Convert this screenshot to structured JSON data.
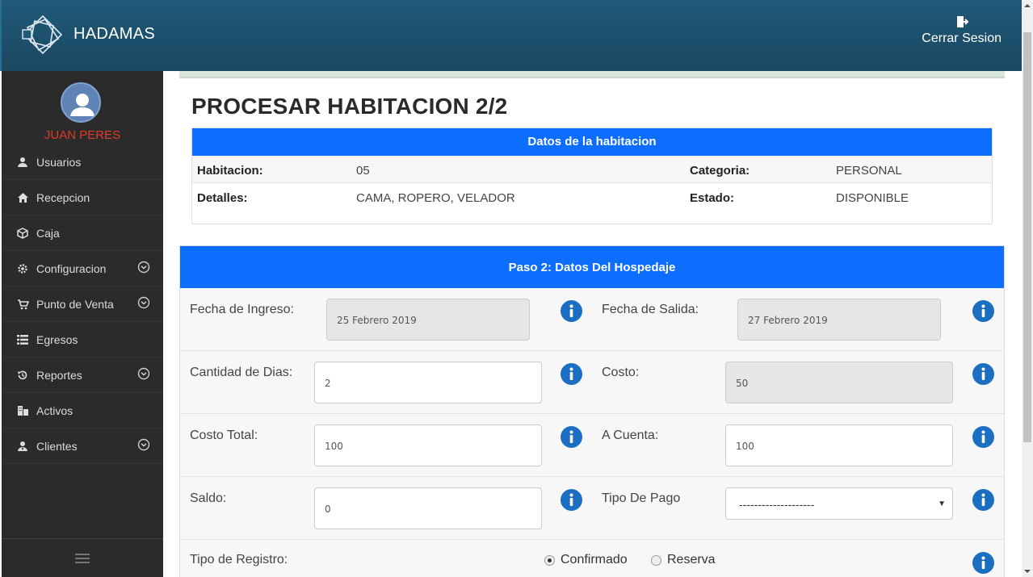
{
  "app": {
    "brand": "HADAMAS",
    "logout_label": "Cerrar Sesion"
  },
  "user": {
    "name": "JUAN PERES"
  },
  "sidebar": {
    "items": [
      {
        "label": "Usuarios",
        "icon": "user-icon",
        "expandable": false
      },
      {
        "label": "Recepcion",
        "icon": "home-icon",
        "expandable": false
      },
      {
        "label": "Caja",
        "icon": "cube-icon",
        "expandable": false
      },
      {
        "label": "Configuracion",
        "icon": "gear-icon",
        "expandable": true
      },
      {
        "label": "Punto de Venta",
        "icon": "cart-icon",
        "expandable": true
      },
      {
        "label": "Egresos",
        "icon": "list-icon",
        "expandable": false
      },
      {
        "label": "Reportes",
        "icon": "history-icon",
        "expandable": true
      },
      {
        "label": "Activos",
        "icon": "building-icon",
        "expandable": false
      },
      {
        "label": "Clientes",
        "icon": "user-tie-icon",
        "expandable": true
      }
    ]
  },
  "page": {
    "title": "PROCESAR HABITACION 2/2"
  },
  "room": {
    "header": "Datos de la habitacion",
    "habitacion_label": "Habitacion:",
    "habitacion_value": "05",
    "categoria_label": "Categoria:",
    "categoria_value": "PERSONAL",
    "detalles_label": "Detalles:",
    "detalles_value": "CAMA, ROPERO, VELADOR",
    "estado_label": "Estado:",
    "estado_value": "DISPONIBLE"
  },
  "stay": {
    "header": "Paso 2: Datos Del Hospedaje",
    "fecha_ingreso_label": "Fecha de Ingreso:",
    "fecha_ingreso_value": "25 Febrero 2019",
    "fecha_salida_label": "Fecha de Salida:",
    "fecha_salida_value": "27 Febrero 2019",
    "cantidad_dias_label": "Cantidad de Dias:",
    "cantidad_dias_value": "2",
    "costo_label": "Costo:",
    "costo_value": "50",
    "costo_total_label": "Costo Total:",
    "costo_total_value": "100",
    "a_cuenta_label": "A Cuenta:",
    "a_cuenta_value": "100",
    "saldo_label": "Saldo:",
    "saldo_value": "0",
    "tipo_pago_label": "Tipo De Pago",
    "tipo_pago_value": "--------------------",
    "tipo_registro_label": "Tipo de Registro:",
    "registro_options": [
      "Confirmado",
      "Reserva"
    ],
    "registro_selected": "Confirmado"
  },
  "colors": {
    "primary": "#0d6efd",
    "topbar": "#1f5a79",
    "sidebar": "#2b2b2b",
    "info": "#1b6ec2",
    "username": "#e23a27"
  }
}
